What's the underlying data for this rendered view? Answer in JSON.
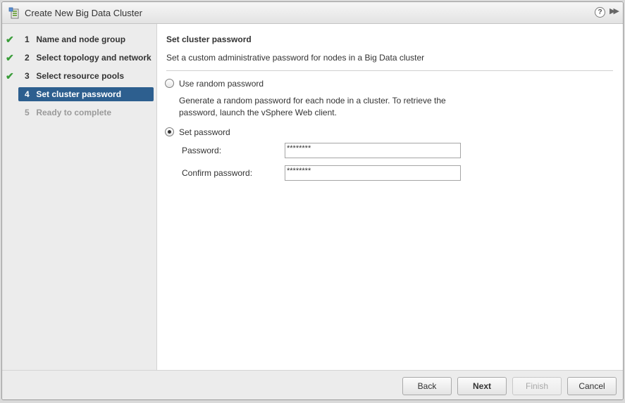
{
  "window": {
    "title": "Create New Big Data Cluster",
    "help_label": "?",
    "expand_label": "▶▶"
  },
  "steps": [
    {
      "number": "1",
      "label": "Name and node group",
      "state": "done"
    },
    {
      "number": "2",
      "label": "Select topology and network",
      "state": "done"
    },
    {
      "number": "3",
      "label": "Select resource pools",
      "state": "done"
    },
    {
      "number": "4",
      "label": "Set cluster password",
      "state": "active"
    },
    {
      "number": "5",
      "label": "Ready to complete",
      "state": "pending"
    }
  ],
  "page": {
    "title": "Set cluster password",
    "description": "Set a custom administrative password for nodes in a Big Data cluster",
    "option_random": {
      "label": "Use random password",
      "help": "Generate a random password for each node in a cluster. To retrieve the password, launch the vSphere Web client.",
      "checked": false
    },
    "option_set": {
      "label": "Set password",
      "checked": true
    },
    "password": {
      "label": "Password:",
      "value": "********"
    },
    "confirm_password": {
      "label": "Confirm password:",
      "value": "********"
    }
  },
  "footer": {
    "back_label": "Back",
    "next_label": "Next",
    "finish_label": "Finish",
    "cancel_label": "Cancel"
  },
  "colors": {
    "active_step": "#2d5f8f",
    "check": "#3a9d3a"
  }
}
